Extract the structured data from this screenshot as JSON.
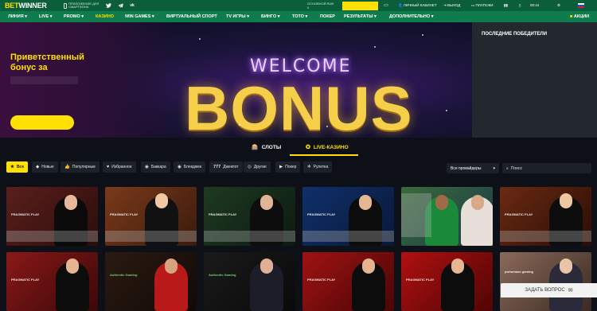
{
  "header": {
    "logo_bet": "BET",
    "logo_winner": "WINNER",
    "app_download": "ПРИЛОЖЕНИЕ ДЛЯ СМАРТФОНА",
    "social": [
      "twitter-icon",
      "telegram-icon",
      "vk-icon"
    ],
    "balance_label": "ОСНОВНОЙ RUB",
    "balance_value": "0",
    "personal_account": "ЛИЧНЫЙ КАБИНЕТ",
    "logout": "ВЫХОД",
    "payments": "ПЛАТЕЖИ",
    "time": "00:44",
    "colors": {
      "topbar": "#0b5e3a",
      "navbar": "#0e7c4c",
      "accent": "#ffe000"
    }
  },
  "nav": {
    "items": [
      "ЛИНИЯ",
      "LIVE",
      "PROMO",
      "КАЗИНО",
      "WIN GAMES",
      "ВИРТУАЛЬНЫЙ СПОРТ",
      "TV ИГРЫ",
      "БИНГО",
      "ТОТО",
      "ПОКЕР",
      "РЕЗУЛЬТАТЫ",
      "ДОПОЛНИТЕЛЬНО"
    ],
    "active": "КАЗИНО",
    "promotions": "АКЦИИ"
  },
  "banner": {
    "bonus_line1": "Приветственный",
    "bonus_line2": "бонус за",
    "welcome": "WELCOME",
    "bonus": "BONUS"
  },
  "winners": {
    "title": "ПОСЛЕДНИЕ ПОБЕДИТЕЛИ"
  },
  "tabs": [
    {
      "label": "СЛОТЫ",
      "icon": "slot-machine-icon",
      "active": false
    },
    {
      "label": "LIVE-КАЗИНО",
      "icon": "live-casino-icon",
      "active": true
    }
  ],
  "filters": {
    "chips": [
      {
        "label": "Все",
        "icon": "star-icon",
        "active": true
      },
      {
        "label": "Новые",
        "icon": "new-icon",
        "active": false
      },
      {
        "label": "Популярные",
        "icon": "thumbs-up-icon",
        "active": false
      },
      {
        "label": "Избранное",
        "icon": "heart-icon",
        "active": false
      },
      {
        "label": "Баккара",
        "icon": "baccarat-icon",
        "active": false
      },
      {
        "label": "Блекджек",
        "icon": "blackjack-icon",
        "active": false
      },
      {
        "label": "Джекпот",
        "icon": "jackpot-icon",
        "active": false
      },
      {
        "label": "Другие",
        "icon": "other-icon",
        "active": false
      },
      {
        "label": "Покер",
        "icon": "poker-icon",
        "active": false
      },
      {
        "label": "Рулетка",
        "icon": "roulette-icon",
        "active": false
      }
    ],
    "provider": "Все провайдеры",
    "search_placeholder": "Поиск"
  },
  "games": [
    {
      "brand": "PRAGMATIC PLAY"
    },
    {
      "brand": "PRAGMATIC PLAY"
    },
    {
      "brand": "PRAGMATIC PLAY"
    },
    {
      "brand": "PRAGMATIC PLAY"
    },
    {
      "brand": ""
    },
    {
      "brand": "PRAGMATIC PLAY"
    },
    {
      "brand": "PRAGMATIC PLAY"
    },
    {
      "brand": "Authentic Gaming"
    },
    {
      "brand": "Authentic Gaming"
    },
    {
      "brand": "PRAGMATIC PLAY"
    },
    {
      "brand": "PRAGMATIC PLAY"
    },
    {
      "brand": "portomaso gaming"
    }
  ],
  "chat": {
    "label": "ЗАДАТЬ ВОПРОС"
  }
}
